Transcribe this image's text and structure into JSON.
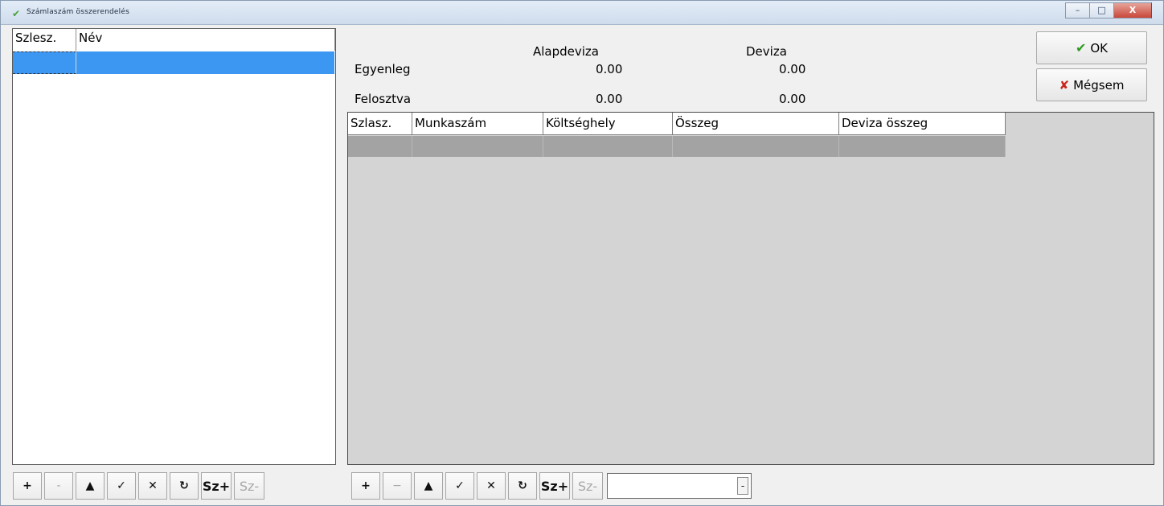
{
  "window": {
    "title": "Számlaszám összerendelés",
    "minimize_label": "–",
    "maximize_label": "□",
    "close_label": "X"
  },
  "left_grid": {
    "columns": [
      "Szlesz.",
      "Név"
    ]
  },
  "summary": {
    "col_base": "Alapdeviza",
    "col_currency": "Deviza",
    "row_balance_label": "Egyenleg",
    "row_balance_base": "0.00",
    "row_balance_currency": "0.00",
    "row_distributed_label": "Felosztva",
    "row_distributed_base": "0.00",
    "row_distributed_currency": "0.00"
  },
  "buttons": {
    "ok": "OK",
    "cancel": "Mégsem"
  },
  "right_grid": {
    "columns": [
      "Szlasz.",
      "Munkaszám",
      "Költséghely",
      "Összeg",
      "Deviza összeg"
    ]
  },
  "left_toolbar": {
    "first": "+",
    "prior": "-",
    "up": "▲",
    "post": "✓",
    "cancel": "✕",
    "refresh": "↻",
    "add": "Sz+",
    "remove": "Sz-"
  },
  "right_toolbar": {
    "first": "+",
    "prior": "−",
    "up": "▲",
    "post": "✓",
    "cancel": "✕",
    "refresh": "↻",
    "add": "Sz+",
    "remove": "Sz-",
    "combo_value": "",
    "combo_arrow": "-"
  }
}
